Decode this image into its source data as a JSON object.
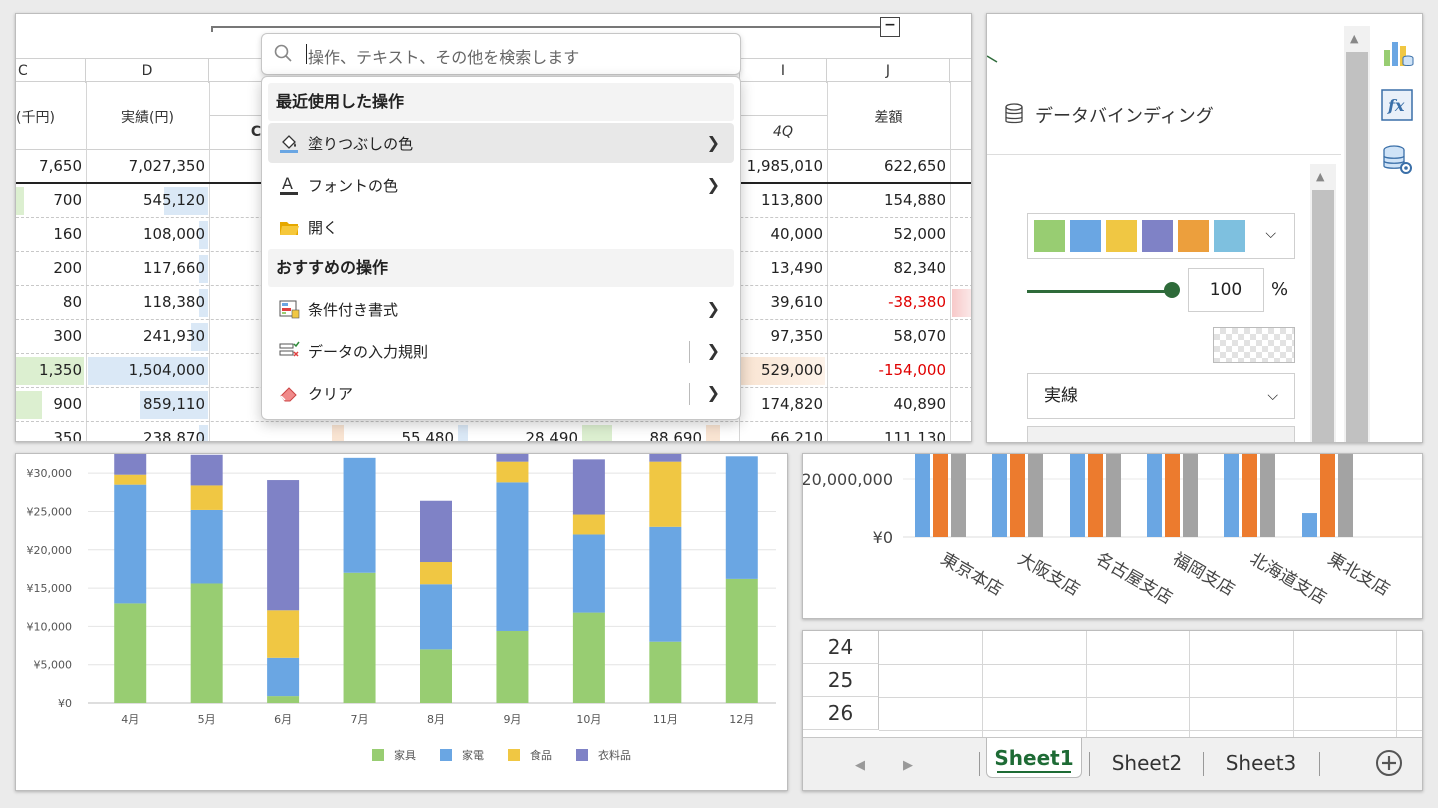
{
  "sheet": {
    "columns": [
      {
        "id": "c",
        "label": "C"
      },
      {
        "id": "d",
        "label": "D"
      },
      {
        "id": "i",
        "label": "I"
      },
      {
        "id": "j",
        "label": "J"
      }
    ],
    "headers": {
      "c": "(千円)",
      "d": "実績(円)",
      "partial": "C",
      "quarter": "4Q",
      "diff": "差額"
    },
    "rows": [
      {
        "c": "7,650",
        "d": "7,027,350",
        "i": "1,985,010",
        "j": "622,650",
        "total": true
      },
      {
        "c": "700",
        "d": "545,120",
        "i": "113,800",
        "j": "154,880"
      },
      {
        "c": "160",
        "d": "108,000",
        "i": "40,000",
        "j": "52,000"
      },
      {
        "c": "200",
        "d": "117,660",
        "i": "13,490",
        "j": "82,340"
      },
      {
        "c": "80",
        "d": "118,380",
        "i": "39,610",
        "j": "-38,380",
        "neg": true
      },
      {
        "c": "300",
        "d": "241,930",
        "i": "97,350",
        "j": "58,070"
      },
      {
        "c": "1,350",
        "d": "1,504,000",
        "i": "529,000",
        "j": "-154,000",
        "neg": true
      },
      {
        "c": "900",
        "d": "859,110",
        "i": "174,820",
        "j": "40,890"
      },
      {
        "c": "350",
        "d": "238,870",
        "i": "66,210",
        "j": "111,130",
        "mid": [
          "55,480",
          "28,490",
          "88,690"
        ]
      }
    ]
  },
  "search": {
    "placeholder": "操作、テキスト、その他を検索します"
  },
  "menu": {
    "recent_title": "最近使用した操作",
    "recommended_title": "おすすめの操作",
    "recent_items": [
      {
        "label": "塗りつぶしの色",
        "icon": "fill-color-icon"
      },
      {
        "label": "フォントの色",
        "icon": "font-color-icon"
      },
      {
        "label": "開く",
        "icon": "folder-open-icon"
      }
    ],
    "recommended_items": [
      {
        "label": "条件付き書式",
        "icon": "conditional-format-icon"
      },
      {
        "label": "データの入力規則",
        "icon": "data-validation-icon"
      },
      {
        "label": "クリア",
        "icon": "eraser-icon"
      }
    ]
  },
  "pane": {
    "title": "データバインディング",
    "swatches": [
      "#98cd72",
      "#6aa6e3",
      "#f0c743",
      "#7f82c6",
      "#ec9f3d",
      "#7ec0df"
    ],
    "opacity_value": "100",
    "opacity_unit": "%",
    "opacity_level": 1.0,
    "line_style": "実線",
    "tools": [
      "chart-icon",
      "function-icon",
      "database-settings-icon"
    ]
  },
  "chart_data": [
    {
      "type": "bar",
      "stacked": true,
      "categories": [
        "4月",
        "5月",
        "6月",
        "7月",
        "8月",
        "9月",
        "10月",
        "11月",
        "12月"
      ],
      "series": [
        {
          "name": "家具",
          "color": "#98cd72",
          "values": [
            13000,
            15600,
            900,
            17000,
            7000,
            9400,
            11800,
            8000,
            16200
          ]
        },
        {
          "name": "家電",
          "color": "#6aa6e3",
          "values": [
            15500,
            9600,
            5000,
            15000,
            8500,
            19400,
            10200,
            15000,
            16000
          ]
        },
        {
          "name": "食品",
          "color": "#f0c743",
          "values": [
            1300,
            3200,
            6200,
            0,
            2900,
            2700,
            2600,
            8500,
            0
          ]
        },
        {
          "name": "衣料品",
          "color": "#7f82c6",
          "values": [
            3000,
            4000,
            17000,
            0,
            8000,
            1000,
            7200,
            2500,
            0
          ]
        }
      ],
      "yticks": [
        "¥0",
        "¥5,000",
        "¥10,000",
        "¥15,000",
        "¥20,000",
        "¥25,000",
        "¥30,000"
      ],
      "ylim": [
        0,
        32500
      ],
      "grid": true,
      "legend": "bottom"
    },
    {
      "type": "bar",
      "categories": [
        "東京本店",
        "大阪支店",
        "名古屋支店",
        "福岡支店",
        "北海道支店",
        "東北支店"
      ],
      "series": [
        {
          "color": "#6aa6e3",
          "values": [
            26000000,
            26000000,
            26000000,
            26000000,
            26000000,
            7500000
          ]
        },
        {
          "color": "#ec7b2e",
          "values": [
            26000000,
            26000000,
            26000000,
            26000000,
            26000000,
            26000000
          ]
        },
        {
          "color": "#a3a3a3",
          "values": [
            26000000,
            26000000,
            26000000,
            26000000,
            26000000,
            26000000
          ]
        }
      ],
      "yticks": [
        "¥0",
        "20,000,000"
      ],
      "ylim": [
        0,
        26000000
      ],
      "grid": true
    }
  ],
  "tabs": {
    "rows": [
      "24",
      "25",
      "26"
    ],
    "sheets": [
      {
        "label": "Sheet1",
        "active": true
      },
      {
        "label": "Sheet2",
        "active": false
      },
      {
        "label": "Sheet3",
        "active": false
      }
    ]
  }
}
